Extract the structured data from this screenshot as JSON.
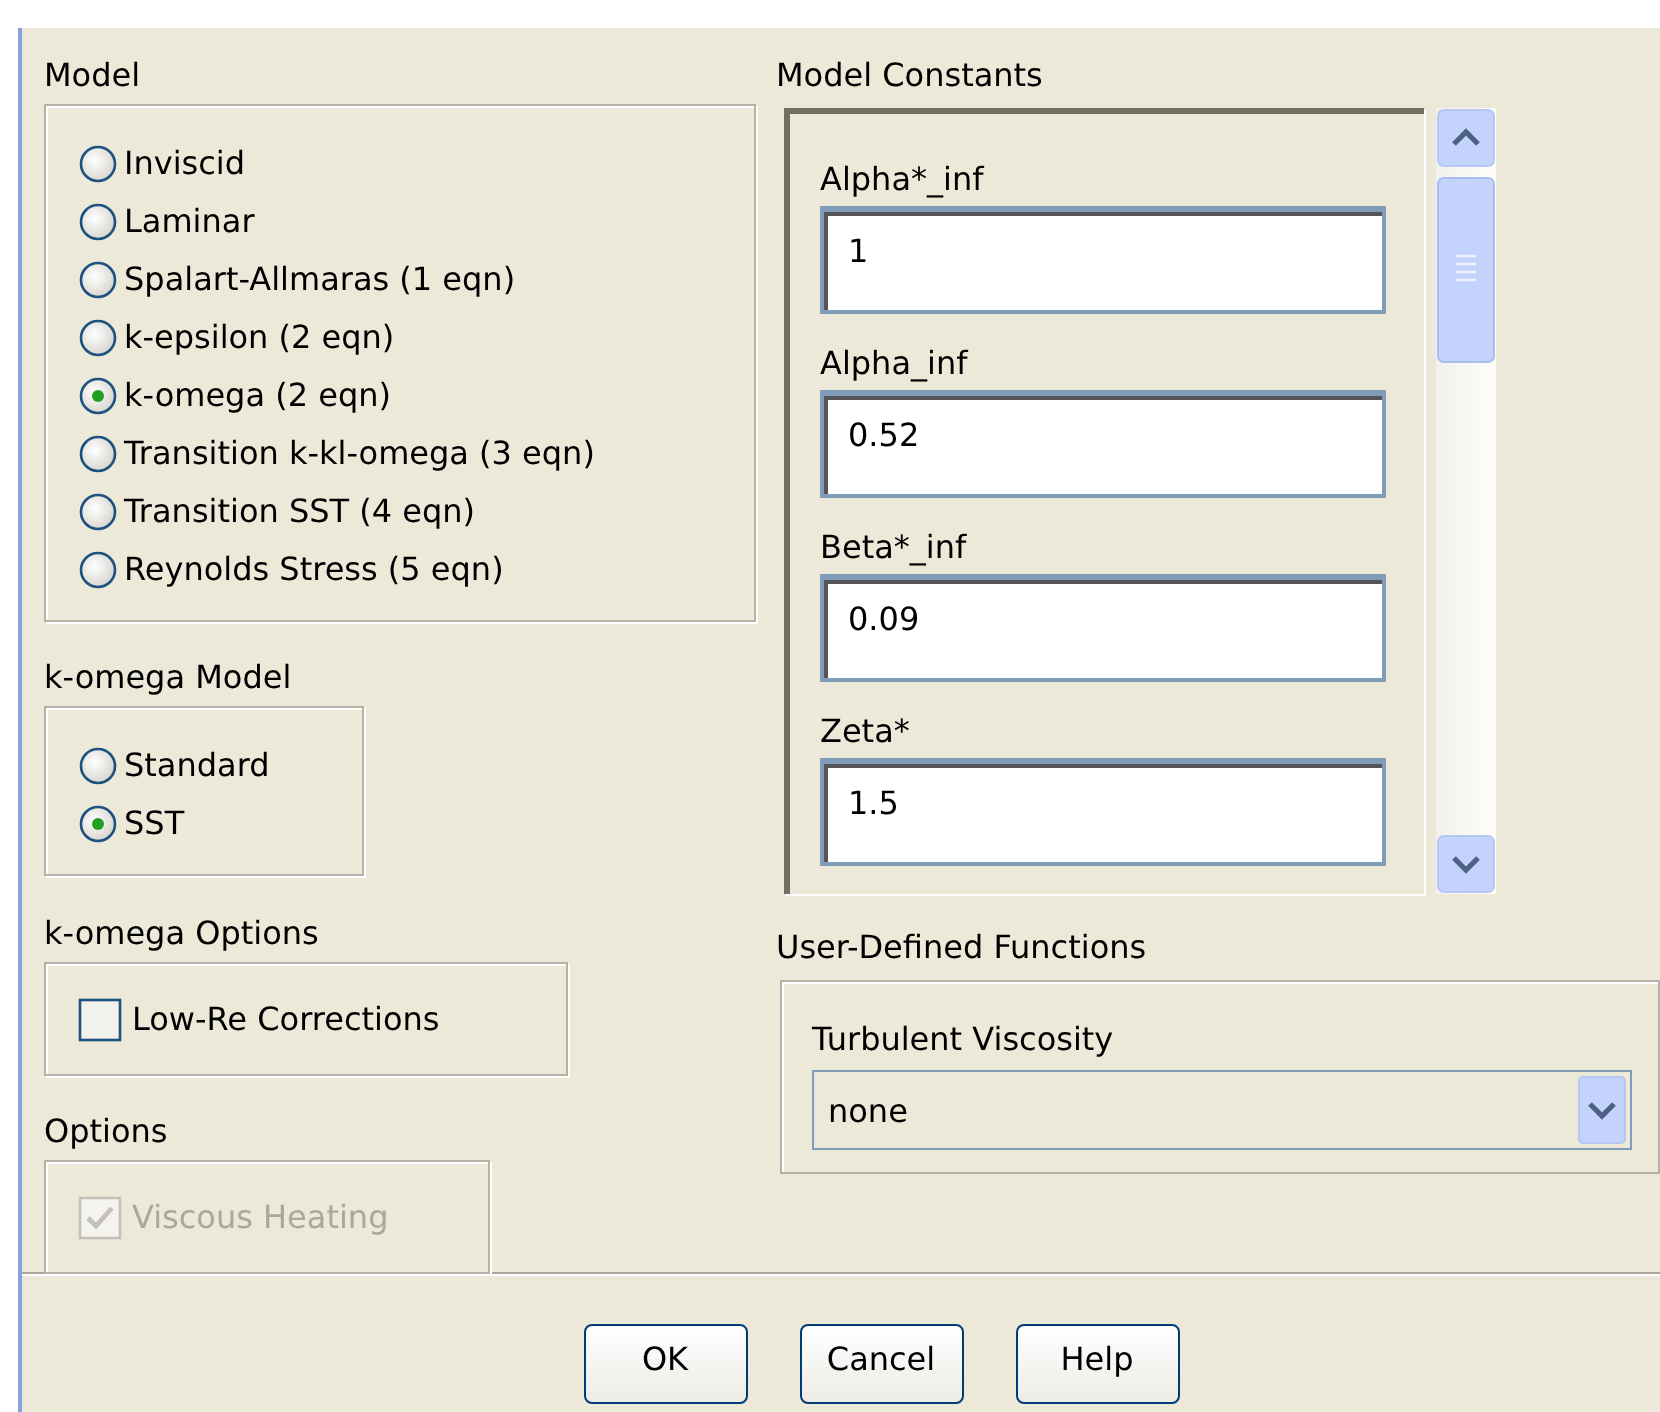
{
  "model": {
    "label": "Model",
    "options": [
      {
        "label": "Inviscid",
        "selected": false
      },
      {
        "label": "Laminar",
        "selected": false
      },
      {
        "label": "Spalart-Allmaras (1 eqn)",
        "selected": false
      },
      {
        "label": "k-epsilon (2 eqn)",
        "selected": false
      },
      {
        "label": "k-omega (2 eqn)",
        "selected": true
      },
      {
        "label": "Transition k-kl-omega (3 eqn)",
        "selected": false
      },
      {
        "label": "Transition SST (4 eqn)",
        "selected": false
      },
      {
        "label": "Reynolds Stress (5 eqn)",
        "selected": false
      }
    ]
  },
  "komega_model": {
    "label": "k-omega Model",
    "options": [
      {
        "label": "Standard",
        "selected": false
      },
      {
        "label": "SST",
        "selected": true
      }
    ]
  },
  "komega_options": {
    "label": "k-omega Options",
    "items": [
      {
        "label": "Low-Re Corrections",
        "checked": false,
        "disabled": false
      }
    ]
  },
  "options": {
    "label": "Options",
    "items": [
      {
        "label": "Viscous Heating",
        "checked": true,
        "disabled": true
      }
    ]
  },
  "model_constants": {
    "label": "Model Constants",
    "fields": [
      {
        "label": "Alpha*_inf",
        "value": "1"
      },
      {
        "label": "Alpha_inf",
        "value": "0.52"
      },
      {
        "label": "Beta*_inf",
        "value": "0.09"
      },
      {
        "label": "Zeta*",
        "value": "1.5"
      }
    ]
  },
  "udf": {
    "label": "User-Defined Functions",
    "fields": [
      {
        "label": "Turbulent Viscosity",
        "value": "none"
      }
    ]
  },
  "buttons": [
    "OK",
    "Cancel",
    "Help"
  ]
}
